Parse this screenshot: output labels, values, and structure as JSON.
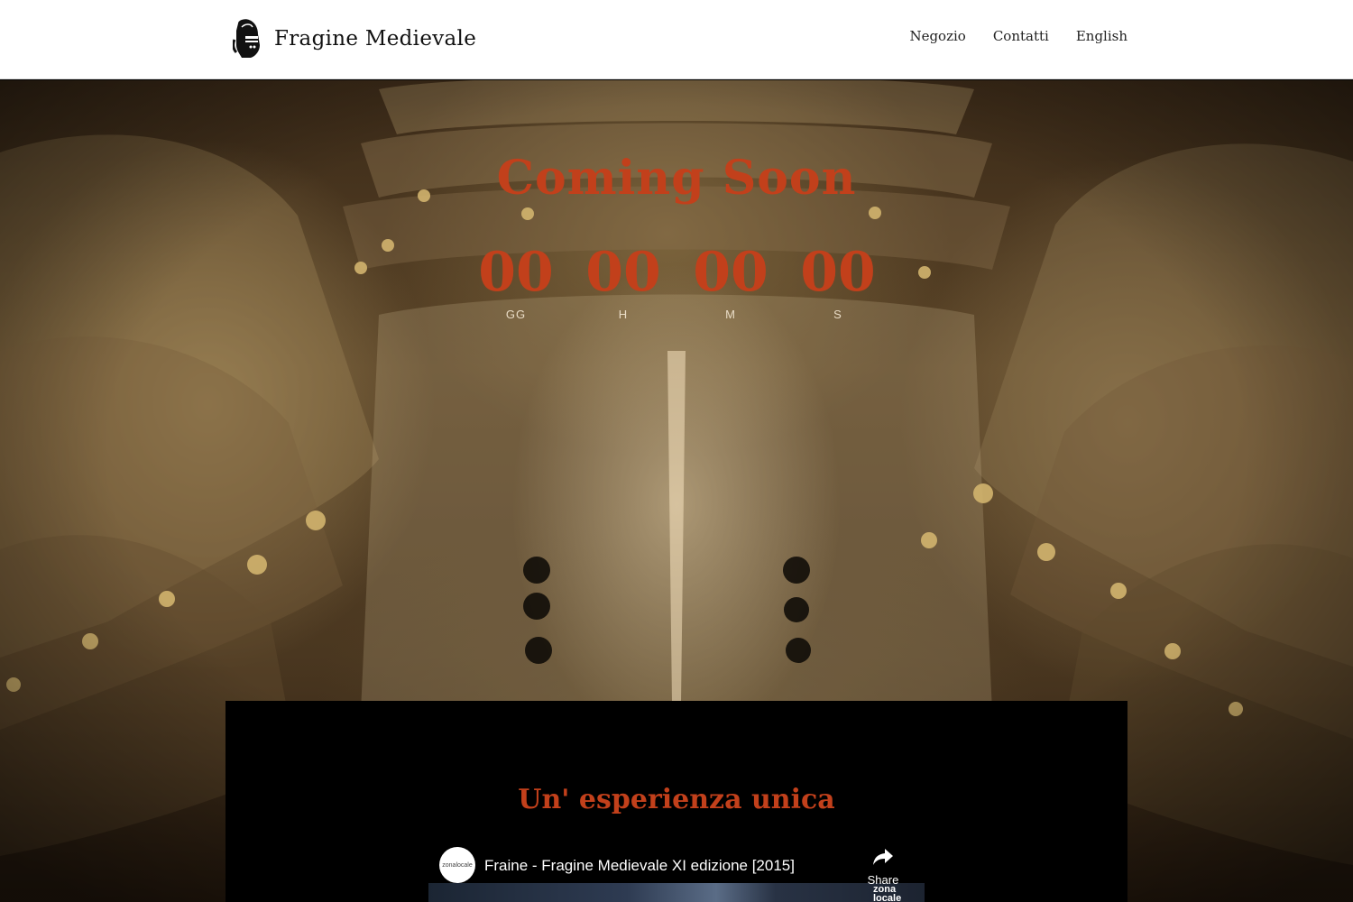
{
  "header": {
    "logo_icon": "knight-helmet-icon",
    "logo_text": "Fragine Medievale",
    "nav": [
      {
        "label": "Negozio"
      },
      {
        "label": "Contatti"
      },
      {
        "label": "English"
      }
    ]
  },
  "hero": {
    "title": "Coming Soon",
    "countdown": [
      {
        "value": "00",
        "label": "GG"
      },
      {
        "value": "00",
        "label": "H"
      },
      {
        "value": "00",
        "label": "M"
      },
      {
        "value": "00",
        "label": "S"
      }
    ]
  },
  "section": {
    "title": "Un' esperienza unica",
    "video": {
      "channel_avatar_text": "zonalocale",
      "title": "Fraine - Fragine Medievale XI edizione [2015]",
      "share_label": "Share",
      "badge_line1": "zona",
      "badge_line2": "locale"
    }
  },
  "colors": {
    "accent": "#c2401b",
    "header_bg": "#ffffff",
    "panel_bg": "#000000"
  }
}
